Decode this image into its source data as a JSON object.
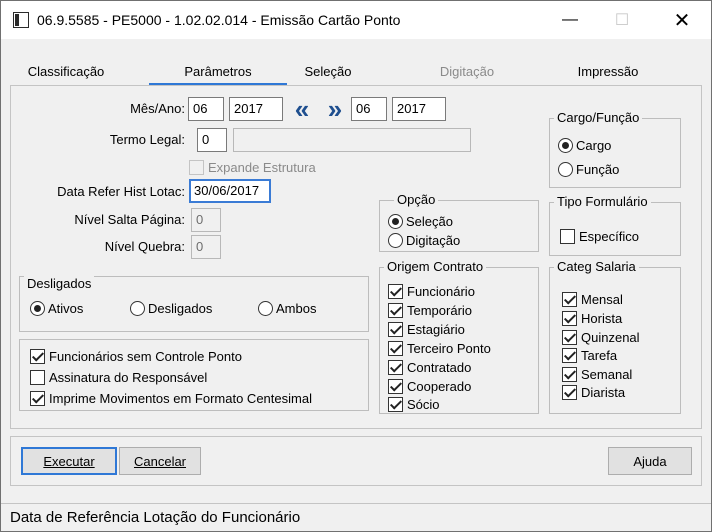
{
  "window": {
    "title": "06.9.5585 - PE5000 - 1.02.02.014 - Emissão Cartão Ponto",
    "minimize_glyph": "—",
    "maximize_glyph": "☐",
    "close_glyph": "✕"
  },
  "tabs": [
    {
      "label": "Classificação",
      "state": "normal"
    },
    {
      "label": "Parâmetros",
      "state": "active"
    },
    {
      "label": "Seleção",
      "state": "normal"
    },
    {
      "label": "Digitação",
      "state": "disabled"
    },
    {
      "label": "Impressão",
      "state": "normal"
    }
  ],
  "form": {
    "mes_ano_label": "Mês/Ano:",
    "mes_inicio": "06",
    "ano_inicio": "2017",
    "prev_glyph": "«",
    "next_glyph": "»",
    "mes_fim": "06",
    "ano_fim": "2017",
    "termo_legal_label": "Termo Legal:",
    "termo_legal_value": "0",
    "termo_legal_desc": "",
    "expande_estrutura_label": "Expande Estrutura",
    "data_refer_label": "Data Refer Hist Lotac:",
    "data_refer_value": "30/06/2017",
    "nivel_salta_label": "Nível Salta Página:",
    "nivel_salta_value": "0",
    "nivel_quebra_label": "Nível Quebra:",
    "nivel_quebra_value": "0"
  },
  "desligados": {
    "title": "Desligados",
    "options": [
      "Ativos",
      "Desligados",
      "Ambos"
    ],
    "selected": "Ativos"
  },
  "options_checks": [
    {
      "label": "Funcionários sem  Controle Ponto",
      "checked": true
    },
    {
      "label": "Assinatura do Responsável",
      "checked": false
    },
    {
      "label": "Imprime Movimentos em Formato Centesimal",
      "checked": true
    }
  ],
  "opcao": {
    "title": "Opção",
    "options": [
      "Seleção",
      "Digitação"
    ],
    "selected": "Seleção"
  },
  "origem_contrato": {
    "title": "Origem Contrato",
    "items": [
      "Funcionário",
      "Temporário",
      "Estagiário",
      "Terceiro Ponto",
      "Contratado",
      "Cooperado",
      "Sócio"
    ]
  },
  "cargo_funcao": {
    "title": "Cargo/Função",
    "options": [
      "Cargo",
      "Função"
    ],
    "selected": "Cargo"
  },
  "tipo_formulario": {
    "title": "Tipo Formulário",
    "especifico_label": "Específico"
  },
  "categ_salaria": {
    "title": "Categ Salaria",
    "items": [
      "Mensal",
      "Horista",
      "Quinzenal",
      "Tarefa",
      "Semanal",
      "Diarista"
    ]
  },
  "buttons": {
    "executar": "Executar",
    "cancelar": "Cancelar",
    "ajuda": "Ajuda"
  },
  "status": {
    "text": "Data de Referência Lotação do Funcionário"
  }
}
